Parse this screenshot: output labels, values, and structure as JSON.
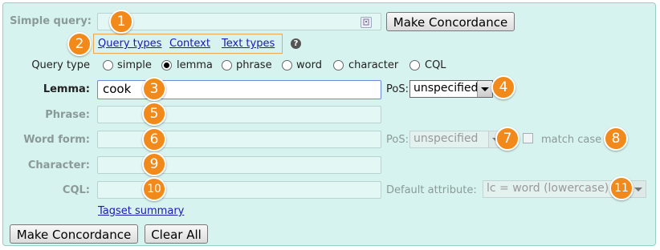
{
  "form": {
    "simple_query": {
      "label": "Simple query:",
      "value": ""
    },
    "make_concordance_top": "Make Concordance",
    "query_tabs": [
      "Query types",
      "Context",
      "Text types"
    ],
    "help_glyph": "?",
    "query_type": {
      "label": "Query type",
      "options": [
        "simple",
        "lemma",
        "phrase",
        "word",
        "character",
        "CQL"
      ],
      "selected": "lemma"
    },
    "lemma": {
      "label": "Lemma:",
      "value": "cook"
    },
    "pos_lemma": {
      "label": "PoS:",
      "value": "unspecified"
    },
    "phrase": {
      "label": "Phrase:",
      "value": ""
    },
    "word_form": {
      "label": "Word form:",
      "value": ""
    },
    "pos_word": {
      "label": "PoS:",
      "value": "unspecified"
    },
    "match_case": {
      "label": "match case",
      "checked": false
    },
    "character": {
      "label": "Character:",
      "value": ""
    },
    "cql": {
      "label": "CQL:",
      "value": ""
    },
    "default_attribute": {
      "label": "Default attribute:",
      "value": "lc = word (lowercase)"
    },
    "tagset_summary": "Tagset summary",
    "make_concordance_bottom": "Make Concordance",
    "clear_all": "Clear All"
  },
  "callouts": [
    "1",
    "2",
    "3",
    "4",
    "5",
    "6",
    "7",
    "8",
    "9",
    "10",
    "11"
  ],
  "colors": {
    "panel_bg": "#d7f3ef",
    "callout": "#f28a1b",
    "link": "#1a1ab0"
  }
}
